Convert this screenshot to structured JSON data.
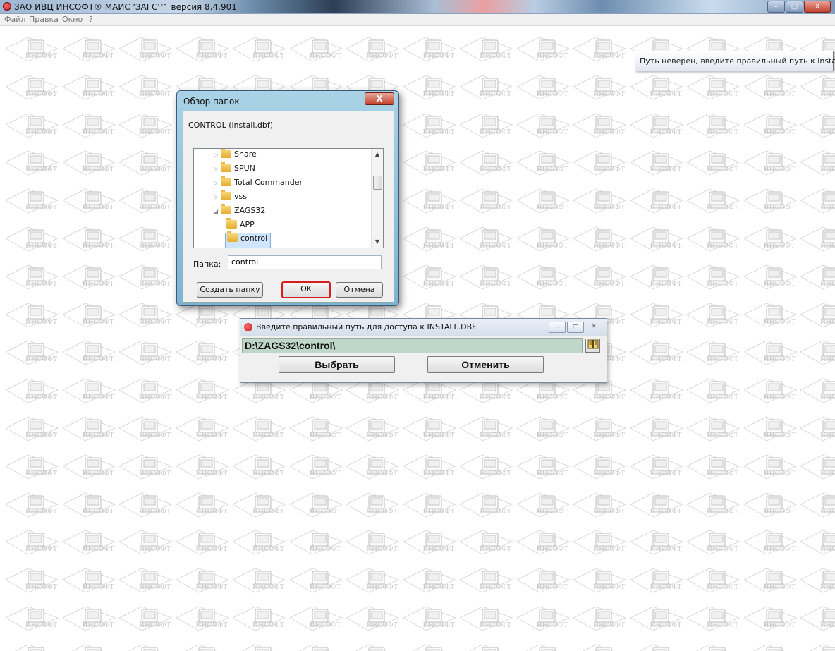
{
  "titlebar": {
    "title": "ЗАО ИВЦ ИНСОФТ®  МАИС 'ЗАГС'™ версия 8.4.901",
    "minimize": "–",
    "maximize": "□",
    "close": "X"
  },
  "menu": {
    "file": "Файл",
    "edit": "Правка",
    "window": "Окно",
    "help": "?"
  },
  "background": {
    "tile_label": "ИНСОФТ"
  },
  "tooltip": {
    "text": "Путь неверен, введите правильный путь к install.dbf"
  },
  "browse_dialog": {
    "title": "Обзор папок",
    "close": "X",
    "description": "CONTROL (install.dbf)",
    "tree": [
      {
        "label": "Share",
        "arrow": "▷"
      },
      {
        "label": "SPUN",
        "arrow": "▷"
      },
      {
        "label": "Total Commander",
        "arrow": "▷"
      },
      {
        "label": "vss",
        "arrow": "▷"
      },
      {
        "label": "ZAGS32",
        "arrow": "◢"
      },
      {
        "label": "APP",
        "arrow": ""
      },
      {
        "label": "control",
        "arrow": ""
      }
    ],
    "scroll_up": "▲",
    "scroll_down": "▼",
    "folder_label": "Папка:",
    "folder_value": "control",
    "create_button": "Создать папку",
    "ok_button": "OK",
    "cancel_button": "Отмена"
  },
  "path_dialog": {
    "title": "Введите правильный путь для доступа к INSTALL.DBF",
    "minimize": "–",
    "maximize": "□",
    "close": "✕",
    "path_value": "D:\\ZAGS32\\control\\",
    "browse_icon": "book-icon",
    "select_button": "Выбрать",
    "cancel_button": "Отменить"
  }
}
